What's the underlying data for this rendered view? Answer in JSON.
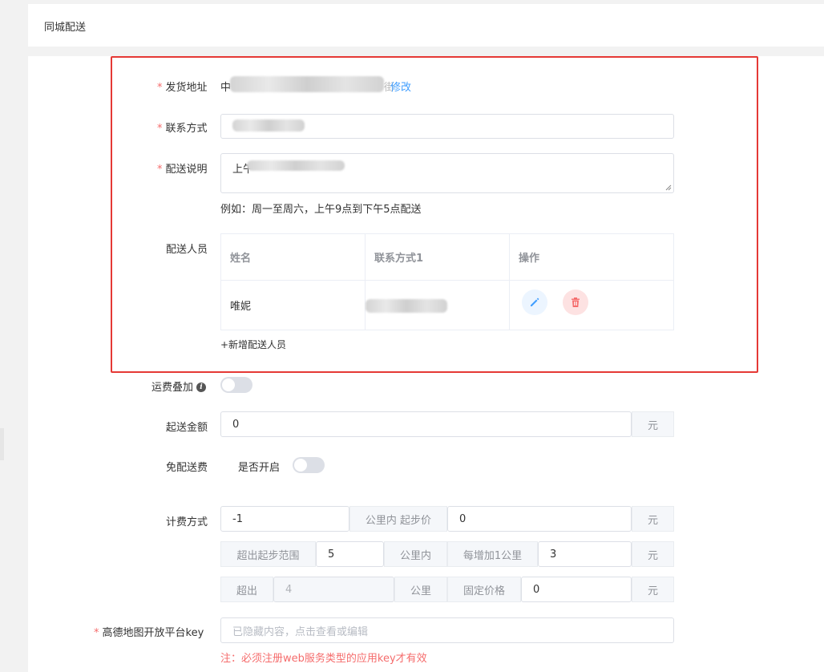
{
  "header": {
    "title": "同城配送"
  },
  "form": {
    "ship_address": {
      "label": "发货地址",
      "value_prefix": "中",
      "value_suffix": "街",
      "edit_link": "修改"
    },
    "contact": {
      "label": "联系方式"
    },
    "delivery_note": {
      "label": "配送说明",
      "value_prefix": "上午",
      "example": "例如：周一至周六，上午9点到下午5点配送"
    },
    "staff": {
      "label": "配送人员",
      "columns": [
        "姓名",
        "联系方式1",
        "操作"
      ],
      "rows": [
        {
          "name": "唯妮"
        }
      ],
      "add_link": "+新增配送人员"
    },
    "freight_stack": {
      "label": "运费叠加",
      "info_icon": "i"
    },
    "min_amount": {
      "label": "起送金额",
      "value": "0",
      "unit": "元"
    },
    "free_delivery": {
      "label": "免配送费",
      "toggle_label": "是否开启"
    },
    "billing": {
      "label": "计费方式",
      "row1": {
        "value": "-1",
        "addon": "公里内 起步价",
        "price": "0",
        "unit": "元"
      },
      "row2": {
        "prefix": "超出起步范围",
        "value": "5",
        "addon": "公里内",
        "addon2": "每增加1公里",
        "price": "3",
        "unit": "元"
      },
      "row3": {
        "prefix": "超出",
        "value": "4",
        "addon": "公里",
        "addon2": "固定价格",
        "price": "0",
        "unit": "元"
      }
    },
    "amap_key": {
      "label": "高德地图开放平台key",
      "placeholder": "已隐藏内容，点击查看或编辑",
      "note": "注：必须注册web服务类型的应用key才有效"
    }
  },
  "colors": {
    "required": "#f56c6c",
    "link": "#409eff",
    "highlight_border": "#e53935"
  }
}
